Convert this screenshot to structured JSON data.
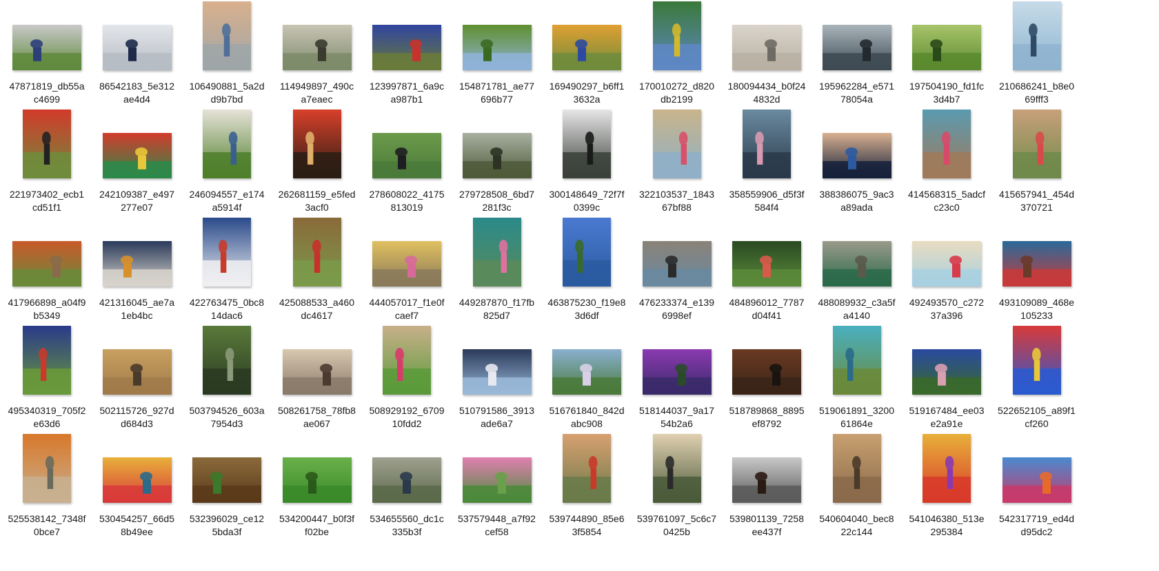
{
  "files": [
    {
      "name1": "47871819_db55a",
      "name2": "c4699",
      "colors": [
        "#5f8a3c",
        "#c9c9c9",
        "#2c3f7a"
      ],
      "orientation": "landscape"
    },
    {
      "name1": "86542183_5e312",
      "name2": "ae4d4",
      "colors": [
        "#b6bcc4",
        "#e3e6ea",
        "#1d2a4a"
      ],
      "orientation": "landscape"
    },
    {
      "name1": "106490881_5a2d",
      "name2": "d9b7bd",
      "colors": [
        "#9fa6a8",
        "#d9b08c",
        "#4f6f9a"
      ],
      "orientation": "portrait"
    },
    {
      "name1": "114949897_490c",
      "name2": "a7eaec",
      "colors": [
        "#7d8b6a",
        "#c7c4b4",
        "#3a3a2f"
      ],
      "orientation": "landscape"
    },
    {
      "name1": "123997871_6a9c",
      "name2": "a987b1",
      "colors": [
        "#6a7b3a",
        "#3045a0",
        "#c7332c"
      ],
      "orientation": "landscape"
    },
    {
      "name1": "154871781_ae77",
      "name2": "696b77",
      "colors": [
        "#8fb3d8",
        "#5f8f2f",
        "#3a6a22"
      ],
      "orientation": "landscape"
    },
    {
      "name1": "169490297_b6ff1",
      "name2": "3632a",
      "colors": [
        "#6f8b3c",
        "#e0a032",
        "#2d4aa0"
      ],
      "orientation": "landscape"
    },
    {
      "name1": "170010272_d820",
      "name2": "db2199",
      "colors": [
        "#5e87c4",
        "#3a7a3a",
        "#d4b82c"
      ],
      "orientation": "portrait"
    },
    {
      "name1": "180094434_b0f24",
      "name2": "4832d",
      "colors": [
        "#b8b0a2",
        "#d9d4cb",
        "#6e6a64"
      ],
      "orientation": "landscape"
    },
    {
      "name1": "195962284_e571",
      "name2": "78054a",
      "colors": [
        "#3d4a52",
        "#a9b4bb",
        "#222a30"
      ],
      "orientation": "landscape"
    },
    {
      "name1": "197504190_fd1fc",
      "name2": "3d4b7",
      "colors": [
        "#5b8a2e",
        "#a8c46a",
        "#2a4a1a"
      ],
      "orientation": "landscape"
    },
    {
      "name1": "210686241_b8e0",
      "name2": "69fff3",
      "colors": [
        "#8fb4d0",
        "#c6dbe8",
        "#2e4a66"
      ],
      "orientation": "portrait"
    },
    {
      "name1": "221973402_ecb1",
      "name2": "cd51f1",
      "colors": [
        "#6f8c3c",
        "#d23a2a",
        "#222222"
      ],
      "orientation": "portrait"
    },
    {
      "name1": "242109387_e497",
      "name2": "277e07",
      "colors": [
        "#2c8a4a",
        "#d23c2c",
        "#e8c83a"
      ],
      "orientation": "landscape"
    },
    {
      "name1": "246094557_e174",
      "name2": "a5914f",
      "colors": [
        "#4e7f2a",
        "#e6e2d8",
        "#3a5f8f"
      ],
      "orientation": "portrait"
    },
    {
      "name1": "262681159_e5fed",
      "name2": "3acf0",
      "colors": [
        "#2a1d14",
        "#d8402a",
        "#e0b06a"
      ],
      "orientation": "portrait"
    },
    {
      "name1": "278608022_4175",
      "name2": "813019",
      "colors": [
        "#4a7a3a",
        "#6c9a4a",
        "#1e1e22"
      ],
      "orientation": "landscape"
    },
    {
      "name1": "279728508_6bd7",
      "name2": "281f3c",
      "colors": [
        "#4e5a3a",
        "#a8b0a0",
        "#2c3324"
      ],
      "orientation": "landscape"
    },
    {
      "name1": "300148649_72f7f",
      "name2": "0399c",
      "colors": [
        "#3a3f3a",
        "#e6e6e6",
        "#1a1a1a"
      ],
      "orientation": "portrait"
    },
    {
      "name1": "322103537_1843",
      "name2": "67bf88",
      "colors": [
        "#8fb0c8",
        "#c8b48a",
        "#d8506a"
      ],
      "orientation": "portrait"
    },
    {
      "name1": "358559906_d5f3f",
      "name2": "584f4",
      "colors": [
        "#2a3a4a",
        "#6a8aa0",
        "#d89ab0"
      ],
      "orientation": "portrait"
    },
    {
      "name1": "388386075_9ac3",
      "name2": "a89ada",
      "colors": [
        "#14203a",
        "#d8b090",
        "#2c5aa0"
      ],
      "orientation": "landscape"
    },
    {
      "name1": "414568315_5adcf",
      "name2": "c23c0",
      "colors": [
        "#a07a5a",
        "#5a9ab0",
        "#d84a6a"
      ],
      "orientation": "portrait"
    },
    {
      "name1": "415657941_454d",
      "name2": "370721",
      "colors": [
        "#6f8a4a",
        "#c8a07a",
        "#d84a4a"
      ],
      "orientation": "portrait"
    },
    {
      "name1": "417966898_a04f9",
      "name2": "b5349",
      "colors": [
        "#6a8a3a",
        "#c85a2a",
        "#8a6a4a"
      ],
      "orientation": "landscape"
    },
    {
      "name1": "421316045_ae7a",
      "name2": "1eb4bc",
      "colors": [
        "#d8d4cc",
        "#2a3a5a",
        "#d8902a"
      ],
      "orientation": "landscape"
    },
    {
      "name1": "422763475_0bc8",
      "name2": "14dac6",
      "colors": [
        "#f0f0f2",
        "#2a4a8a",
        "#c83a2a"
      ],
      "orientation": "portrait"
    },
    {
      "name1": "425088533_a460",
      "name2": "dc4617",
      "colors": [
        "#7a9a4a",
        "#8a6a3a",
        "#c8302a"
      ],
      "orientation": "portrait"
    },
    {
      "name1": "444057017_f1e0f",
      "name2": "caef7",
      "colors": [
        "#8a7a5a",
        "#e0c060",
        "#d86a9a"
      ],
      "orientation": "landscape"
    },
    {
      "name1": "449287870_f17fb",
      "name2": "825d7",
      "colors": [
        "#5a8a5a",
        "#2a8a8a",
        "#e070a0"
      ],
      "orientation": "portrait"
    },
    {
      "name1": "463875230_f19e8",
      "name2": "3d6df",
      "colors": [
        "#2a5aa0",
        "#4a7ad0",
        "#3a6a2a"
      ],
      "orientation": "portrait"
    },
    {
      "name1": "476233374_e139",
      "name2": "6998ef",
      "colors": [
        "#6a8aa0",
        "#8a8278",
        "#2a2a2a"
      ],
      "orientation": "landscape"
    },
    {
      "name1": "484896012_7787",
      "name2": "d04f41",
      "colors": [
        "#5a8a3a",
        "#2a4a22",
        "#d85a4a"
      ],
      "orientation": "landscape"
    },
    {
      "name1": "488089932_c3a5f",
      "name2": "a4140",
      "colors": [
        "#2a6a4a",
        "#9a9a8a",
        "#5a5a4a"
      ],
      "orientation": "landscape"
    },
    {
      "name1": "492493570_c272",
      "name2": "37a396",
      "colors": [
        "#a8d0e0",
        "#e8dcc0",
        "#d83a4a"
      ],
      "orientation": "landscape"
    },
    {
      "name1": "493109089_468e",
      "name2": "105233",
      "colors": [
        "#c83a3a",
        "#2a6a9a",
        "#6a3a2a"
      ],
      "orientation": "landscape"
    },
    {
      "name1": "495340319_705f2",
      "name2": "e63d6",
      "colors": [
        "#6a9a3a",
        "#2a3a8a",
        "#c83a2a"
      ],
      "orientation": "portrait"
    },
    {
      "name1": "502115726_927d",
      "name2": "d684d3",
      "colors": [
        "#a07a4a",
        "#c8a060",
        "#4a3a2a"
      ],
      "orientation": "landscape"
    },
    {
      "name1": "503794526_603a",
      "name2": "7954d3",
      "colors": [
        "#2a3a22",
        "#5a7a3a",
        "#8a9a7a"
      ],
      "orientation": "portrait"
    },
    {
      "name1": "508261758_78fb8",
      "name2": "ae067",
      "colors": [
        "#8a7a6a",
        "#d8c8b0",
        "#4a3a30"
      ],
      "orientation": "landscape"
    },
    {
      "name1": "508929192_6709",
      "name2": "10fdd2",
      "colors": [
        "#5a9a3a",
        "#c8b08a",
        "#d83a6a"
      ],
      "orientation": "portrait"
    },
    {
      "name1": "510791586_3913",
      "name2": "ade6a7",
      "colors": [
        "#9ab8d8",
        "#2a3a5a",
        "#e8e8f0"
      ],
      "orientation": "landscape"
    },
    {
      "name1": "516761840_842d",
      "name2": "abc908",
      "colors": [
        "#4a7a3a",
        "#8ab0d0",
        "#d8d0e8"
      ],
      "orientation": "landscape"
    },
    {
      "name1": "518144037_9a17",
      "name2": "54b2a6",
      "colors": [
        "#3a2a6a",
        "#8a3ab0",
        "#2a4a2a"
      ],
      "orientation": "landscape"
    },
    {
      "name1": "518789868_8895",
      "name2": "ef8792",
      "colors": [
        "#3a2418",
        "#6a3a22",
        "#1a1410"
      ],
      "orientation": "landscape"
    },
    {
      "name1": "519061891_3200",
      "name2": "61864e",
      "colors": [
        "#6a8a3a",
        "#4ab0c0",
        "#2a6a8a"
      ],
      "orientation": "portrait"
    },
    {
      "name1": "519167484_ee03",
      "name2": "e2a91e",
      "colors": [
        "#3a6a2a",
        "#2a4aa0",
        "#d8a0b0"
      ],
      "orientation": "landscape"
    },
    {
      "name1": "522652105_a89f1",
      "name2": "cf260",
      "colors": [
        "#2a5ad0",
        "#d83a3a",
        "#e8c83a"
      ],
      "orientation": "portrait"
    },
    {
      "name1": "525538142_7348f",
      "name2": "0bce7",
      "colors": [
        "#c8b090",
        "#d8782a",
        "#6a6a5a"
      ],
      "orientation": "portrait"
    },
    {
      "name1": "530454257_66d5",
      "name2": "8b49ee",
      "colors": [
        "#d83a3a",
        "#e8b03a",
        "#2a6a8a"
      ],
      "orientation": "landscape"
    },
    {
      "name1": "532396029_ce12",
      "name2": "5bda3f",
      "colors": [
        "#5a3a1a",
        "#8a6a3a",
        "#3a7a2a"
      ],
      "orientation": "landscape"
    },
    {
      "name1": "534200447_b0f3f",
      "name2": "f02be",
      "colors": [
        "#3a8a2a",
        "#6ab04a",
        "#2a5a1a"
      ],
      "orientation": "landscape"
    },
    {
      "name1": "534655560_dc1c",
      "name2": "335b3f",
      "colors": [
        "#5a6a4a",
        "#a0a090",
        "#2a3a4a"
      ],
      "orientation": "landscape"
    },
    {
      "name1": "537579448_a7f92",
      "name2": "cef58",
      "colors": [
        "#4a8a3a",
        "#e080b0",
        "#6aa04a"
      ],
      "orientation": "landscape"
    },
    {
      "name1": "539744890_85e6",
      "name2": "3f5854",
      "colors": [
        "#6a7a4a",
        "#d8a070",
        "#c83a2a"
      ],
      "orientation": "portrait"
    },
    {
      "name1": "539761097_5c6c7",
      "name2": "0425b",
      "colors": [
        "#4a5a3a",
        "#e0d0b0",
        "#2a2a2a"
      ],
      "orientation": "portrait"
    },
    {
      "name1": "539801139_7258",
      "name2": "ee437f",
      "colors": [
        "#5a5a5a",
        "#c8c8c8",
        "#2a1a14"
      ],
      "orientation": "landscape"
    },
    {
      "name1": "540604040_bec8",
      "name2": "22c144",
      "colors": [
        "#8a6a4a",
        "#c8a070",
        "#4a3a2a"
      ],
      "orientation": "portrait"
    },
    {
      "name1": "541046380_513e",
      "name2": "295384",
      "colors": [
        "#d83a2a",
        "#e8b03a",
        "#8a3ab0"
      ],
      "orientation": "portrait"
    },
    {
      "name1": "542317719_ed4d",
      "name2": "d95dc2",
      "colors": [
        "#c83a6a",
        "#4a8ad0",
        "#e86a2a"
      ],
      "orientation": "landscape"
    }
  ]
}
